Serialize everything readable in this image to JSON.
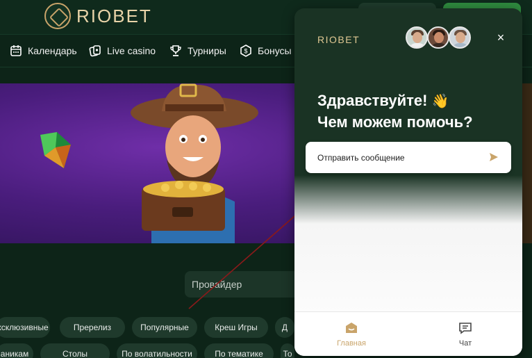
{
  "site": {
    "brand": "RIOBET",
    "nav": [
      {
        "label": "Календарь",
        "icon": "calendar-icon"
      },
      {
        "label": "Live casino",
        "icon": "live-casino-icon"
      },
      {
        "label": "Турниры",
        "icon": "trophy-icon"
      },
      {
        "label": "Бонусы",
        "icon": "bonus-coin-icon"
      }
    ],
    "search": {
      "placeholder": "Провайдер"
    },
    "filters_row1": [
      "ксклюзивные",
      "Пререлиз",
      "Популярные",
      "Креш Игры",
      "Д"
    ],
    "filters_row2": [
      "аникам",
      "Столы",
      "По волатильности",
      "По тематике",
      "То"
    ]
  },
  "widget": {
    "brand": "RIOBET",
    "close_label": "×",
    "greeting_line1": "Здравствуйте!",
    "greeting_emoji": "👋",
    "greeting_line2": "Чем можем помочь?",
    "send_message_label": "Отправить сообщение",
    "tabs": [
      {
        "label": "Главная",
        "icon": "home-icon",
        "active": true
      },
      {
        "label": "Чат",
        "icon": "chat-icon",
        "active": false
      }
    ],
    "accent_color": "#c9a46a"
  }
}
